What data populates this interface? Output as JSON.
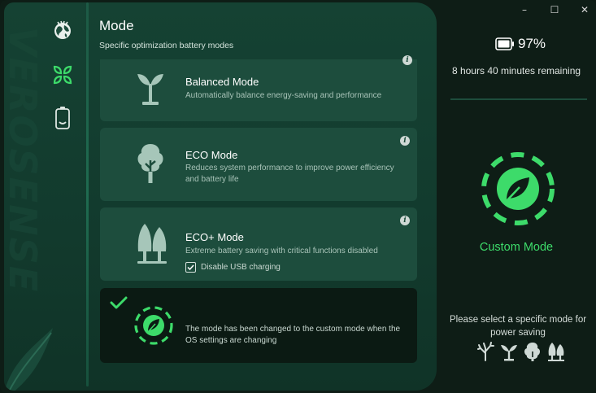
{
  "window": {
    "minimize_glyph": "–",
    "maximize_glyph": "☐",
    "close_glyph": "✕"
  },
  "brand": {
    "watermark_text": "VEROSENSE"
  },
  "sidebar": {
    "items": [
      {
        "name": "earth-icon"
      },
      {
        "name": "leaves-icon",
        "selected": true
      },
      {
        "name": "battery-icon"
      }
    ]
  },
  "header": {
    "title": "Mode",
    "subtitle": "Specific optimization battery modes"
  },
  "cards": [
    {
      "title": "Balanced Mode",
      "description": "Automatically balance energy-saving and performance",
      "icon": "sprout-icon"
    },
    {
      "title": "ECO Mode",
      "description": "Reduces system performance to improve power efficiency and battery life",
      "icon": "tree-icon"
    },
    {
      "title": "ECO+ Mode",
      "description": "Extreme battery saving with critical functions disabled",
      "icon": "forest-icon",
      "checkbox_label": "Disable USB charging",
      "checkbox_checked": true
    },
    {
      "description": "The mode has been changed to the custom mode when the OS settings are changing",
      "icon": "custom-leaf-icon",
      "active": true
    }
  ],
  "info_glyph": "i",
  "status": {
    "battery_percent": "97%",
    "remaining": "8 hours 40 minutes remaining",
    "current_mode": "Custom Mode",
    "hint": "Please select a specific mode for power saving",
    "mode_icons": [
      "bare-tree-icon",
      "sprout-icon",
      "tree-icon",
      "forest-icon"
    ]
  },
  "colors": {
    "accent_green": "#3ddb6a",
    "panel": "#154233",
    "card": "#1d4d3d",
    "active_card": "#0b1a13"
  }
}
